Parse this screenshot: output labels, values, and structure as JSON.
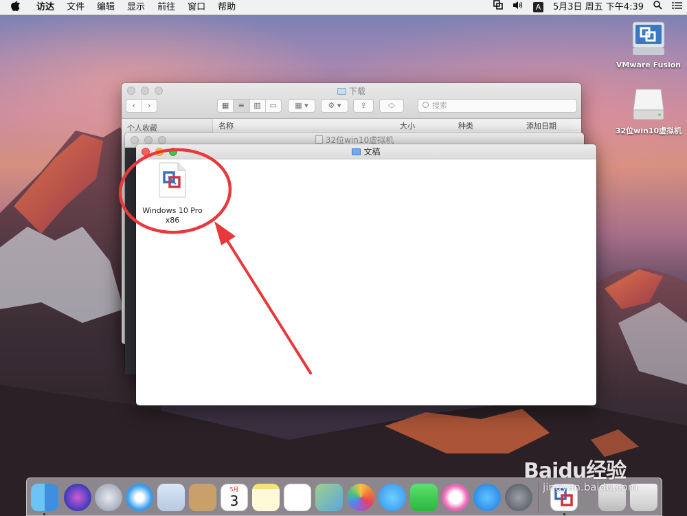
{
  "menubar": {
    "app_name": "访达",
    "menus": [
      "文件",
      "编辑",
      "显示",
      "前往",
      "窗口",
      "帮助"
    ],
    "ime_indicator": "A",
    "clock": "5月3日 周五 下午4:39",
    "status_icons": [
      "vmware-status-icon",
      "volume-icon",
      "spotlight-icon",
      "notification-center-icon"
    ]
  },
  "desktop": {
    "icons": [
      {
        "label": "VMware Fusion",
        "icon": "vmware-fusion-icon"
      },
      {
        "label": "32位win10虚拟机",
        "icon": "drive-icon"
      }
    ]
  },
  "windows": {
    "downloads": {
      "title": "下载",
      "search_placeholder": "搜索",
      "sidebar_header": "个人收藏",
      "columns": [
        "名称",
        "大小",
        "种类",
        "添加日期"
      ]
    },
    "vm32": {
      "title": "32位win10虚拟机"
    },
    "documents": {
      "title": "文稿",
      "files": [
        {
          "name_line1": "Windows 10 Pro",
          "name_line2": "x86",
          "icon": "vmware-vm-document-icon"
        }
      ]
    }
  },
  "annotation": {
    "color": "#e8383b",
    "shapes": [
      "circle-around-file",
      "arrow-pointing-to-file"
    ]
  },
  "dock": {
    "apps": [
      "finder-icon",
      "siri-icon",
      "launchpad-icon",
      "safari-icon",
      "mail-icon",
      "contacts-icon",
      "calendar-icon",
      "notes-icon",
      "reminders-icon",
      "maps-icon",
      "photos-icon",
      "messages-icon",
      "facetime-icon",
      "itunes-icon",
      "app-store-icon",
      "system-preferences-icon",
      "vmware-fusion-icon",
      "downloads-stack-icon",
      "trash-icon"
    ],
    "calendar_month": "5月",
    "calendar_day": "3"
  },
  "watermark": {
    "brand": "Baidu经验",
    "url": "jingyan.baidu.com"
  }
}
